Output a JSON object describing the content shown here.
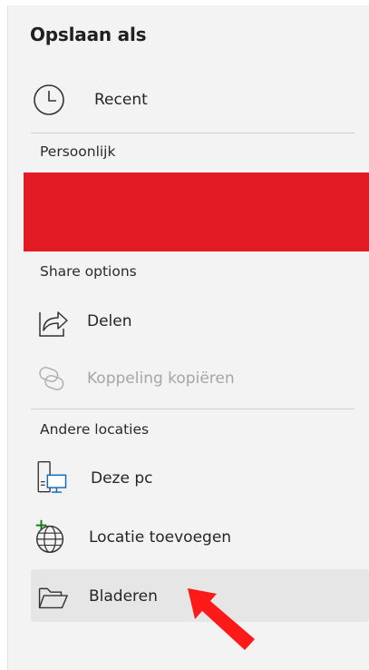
{
  "header": {
    "title": "Opslaan als"
  },
  "recent": {
    "label": "Recent",
    "icon": "clock-icon"
  },
  "sections": {
    "personal": "Persoonlijk",
    "share": "Share options",
    "other": "Andere locaties"
  },
  "share_items": [
    {
      "label": "Delen",
      "icon": "share-icon",
      "enabled": true
    },
    {
      "label": "Koppeling kopiëren",
      "icon": "link-icon",
      "enabled": false
    }
  ],
  "location_items": [
    {
      "label": "Deze pc",
      "icon": "computer-icon"
    },
    {
      "label": "Locatie toevoegen",
      "icon": "globe-add-icon"
    },
    {
      "label": "Bladeren",
      "icon": "folder-icon",
      "selected": true
    }
  ],
  "colors": {
    "redaction": "#e21b24",
    "cursor": "#ff1a1a",
    "accent_blue": "#0f6cbd",
    "accent_green": "#107c10"
  }
}
